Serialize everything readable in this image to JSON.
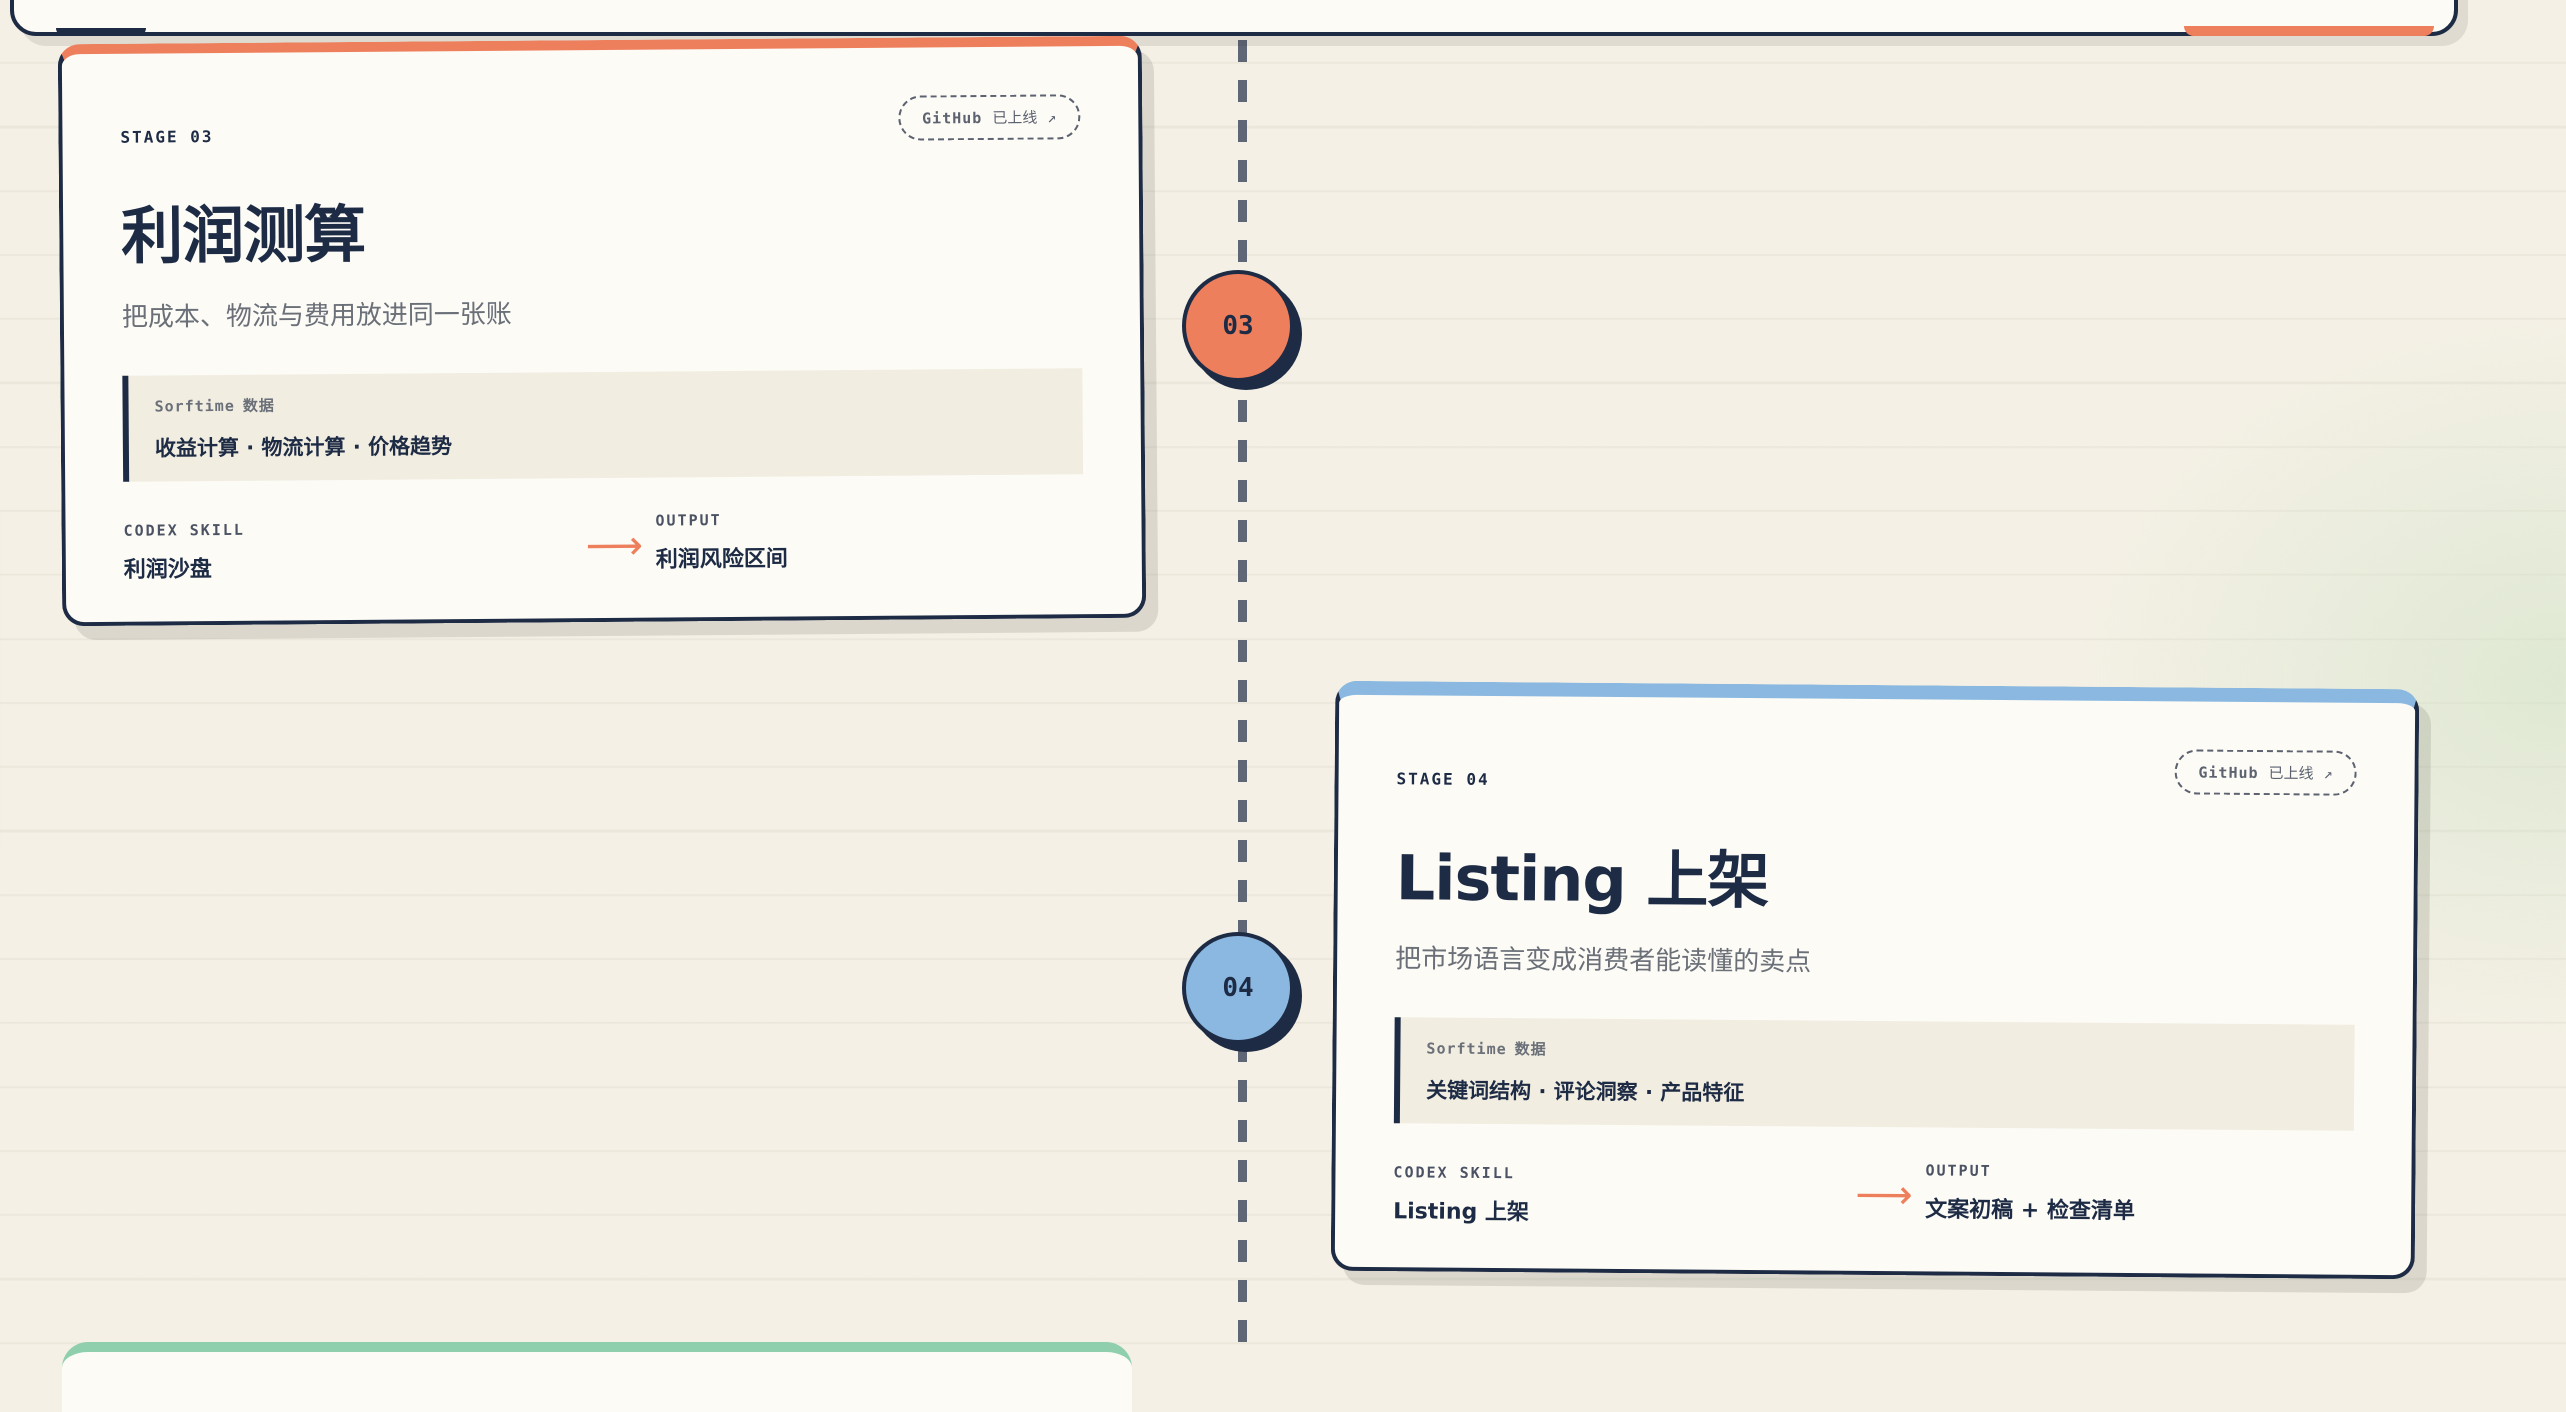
{
  "stages": [
    {
      "stage_label": "STAGE 03",
      "number": "03",
      "badge_text": "GitHub",
      "badge_status": "已上线",
      "badge_icon": "↗",
      "title": "利润测算",
      "subtitle": "把成本、物流与费用放进同一张账",
      "data_source": "Sorftime",
      "data_source_suffix": "数据",
      "data_items": "收益计算 · 物流计算 · 价格趋势",
      "skill_label": "CODEX SKILL",
      "skill_value": "利润沙盘",
      "output_label": "OUTPUT",
      "output_value": "利润风险区间",
      "accent_color": "#ee7f5d"
    },
    {
      "stage_label": "STAGE 04",
      "number": "04",
      "badge_text": "GitHub",
      "badge_status": "已上线",
      "badge_icon": "↗",
      "title": "Listing 上架",
      "subtitle": "把市场语言变成消费者能读懂的卖点",
      "data_source": "Sorftime",
      "data_source_suffix": "数据",
      "data_items": "关键词结构 · 评论洞察 · 产品特征",
      "skill_label": "CODEX SKILL",
      "skill_value": "Listing 上架",
      "output_label": "OUTPUT",
      "output_value": "文案初稿 + 检查清单",
      "accent_color": "#8ab8e0"
    }
  ],
  "arrow_glyph": "⟶",
  "colors": {
    "ink": "#1e2b45",
    "paper": "#fcfbf6",
    "background": "#f4f0e5",
    "coral": "#ee7f5d",
    "sky": "#8ab8e0",
    "mint": "#8fcfae"
  }
}
